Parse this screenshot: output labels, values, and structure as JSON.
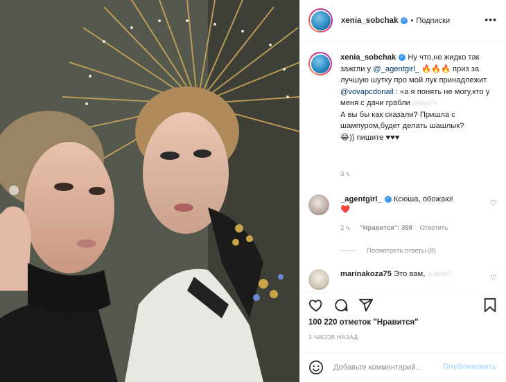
{
  "post": {
    "username": "xenia_sobchak",
    "separator": "•",
    "follow_label": "Подписки",
    "more_label": "•••"
  },
  "caption": {
    "username": "xenia_sobchak",
    "part1": "Ну что,не жидко так зажгли у",
    "mention1": "@_agentgirl_",
    "emoji1": "🔥🔥🔥",
    "part2": "приз за лучшую шутку про мой лук принадлежит",
    "mention2": "@vovapcdonail",
    "part3": ": «а я понять не могу,кто у меня с дачи грабли",
    "blurred": "спер?»",
    "part4": "А вы бы как сказали? Пришла с шампуром,будет делать шашлык?",
    "emoji2": "😂",
    "part5": ")) пишите ♥♥♥",
    "time": "3 ч."
  },
  "comments": [
    {
      "username": "_agentgirl_",
      "text": "Ксюша, обожаю!",
      "emoji": "❤️",
      "time": "2 ч.",
      "likes": "\"Нравится\": 359",
      "reply": "Ответить",
      "view_replies": "Посмотреть ответы (8)"
    },
    {
      "username": "marinakoza75",
      "text": "Это вам,",
      "blurred": "а мне?"
    }
  ],
  "actions": {
    "likes_text": "100 220 отметок \"Нравится\"",
    "ago": "3 ЧАСОВ НАЗАД"
  },
  "composer": {
    "placeholder": "Добавьте комментарий...",
    "publish_label": "Опубликовать"
  },
  "colors": {
    "verified": "#3897f0",
    "link": "#00376b",
    "publish_disabled": "#b2dffc",
    "secondary_text": "#8e8e8e"
  }
}
